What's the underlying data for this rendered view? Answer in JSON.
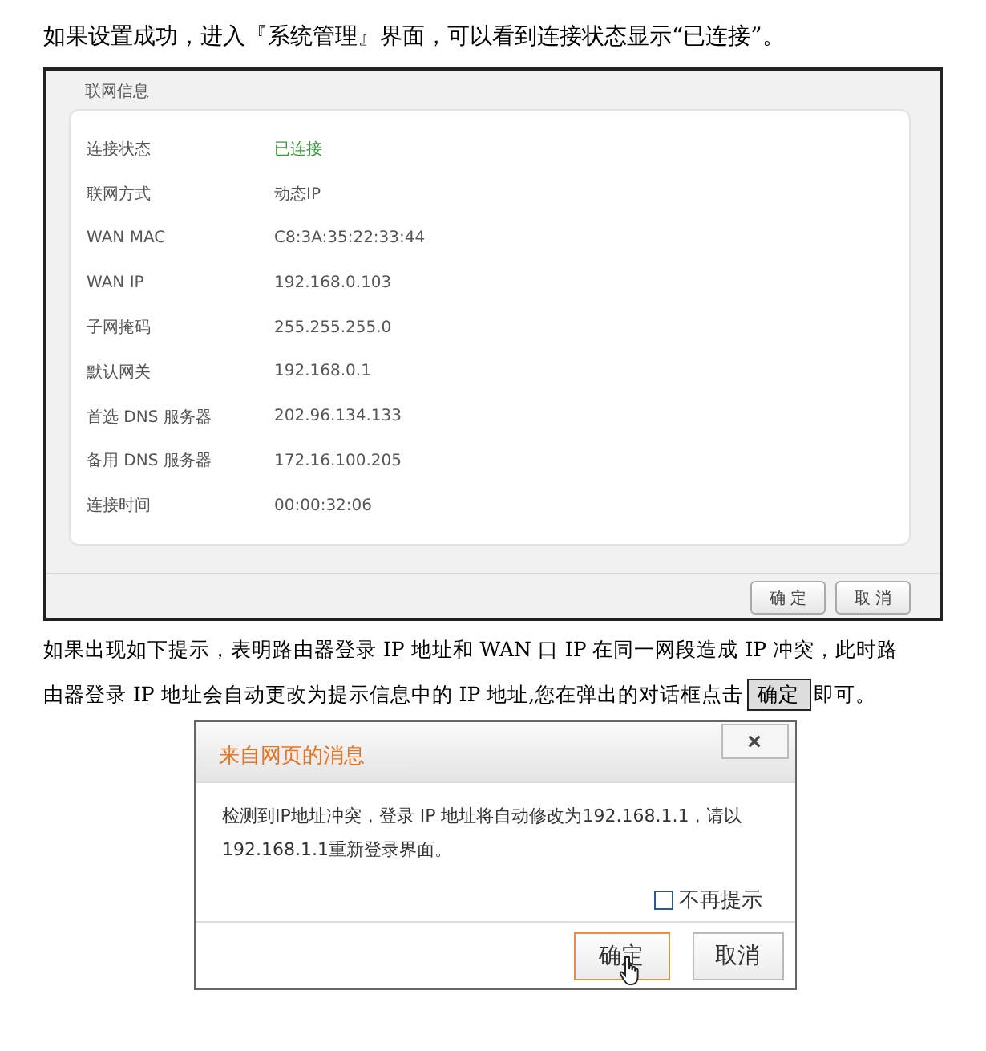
{
  "intro": "如果设置成功，进入『系统管理』界面，可以看到连接状态显示“已连接”。",
  "panel": {
    "title": "联网信息",
    "rows": [
      {
        "label": "连接状态",
        "value": "已连接",
        "kind": "status"
      },
      {
        "label": "联网方式",
        "value": "动态IP",
        "kind": "plain"
      },
      {
        "label": "WAN MAC",
        "value": "C8:3A:35:22:33:44",
        "kind": "plain"
      },
      {
        "label": "WAN IP",
        "value": "192.168.0.103",
        "kind": "plain"
      },
      {
        "label": "子网掩码",
        "value": "255.255.255.0",
        "kind": "plain"
      },
      {
        "label": "默认网关",
        "value": "192.168.0.1",
        "kind": "plain"
      },
      {
        "label": "首选 DNS 服务器",
        "value": "202.96.134.133",
        "kind": "plain"
      },
      {
        "label": "备用 DNS 服务器",
        "value": "172.16.100.205",
        "kind": "plain"
      },
      {
        "label": "连接时间",
        "value": "00:00:32:06",
        "kind": "plain"
      }
    ],
    "buttons": [
      "确 定",
      "取 消"
    ]
  },
  "note": {
    "line_1": "如果出现如下提示，表明路由器登录 IP 地址和 WAN 口 IP 在同一网段造成 IP 冲突，此时路",
    "text_before": "由器登录 IP 地址会自动更改为提示信息中的 IP 地址,您在弹出的对话框点击",
    "button": "确定",
    "text_after": "即可。"
  },
  "dialog": {
    "title": "来自网页的消息",
    "close": "×",
    "message": "检测到IP地址冲突，登录 IP 地址将自动修改为192.168.1.1，请以192.168.1.1重新登录界面。",
    "checkbox": {
      "label": "不再提示",
      "checked": false
    },
    "buttons": [
      {
        "label": "确定",
        "focused": true
      },
      {
        "label": "取消",
        "focused": false
      }
    ]
  }
}
